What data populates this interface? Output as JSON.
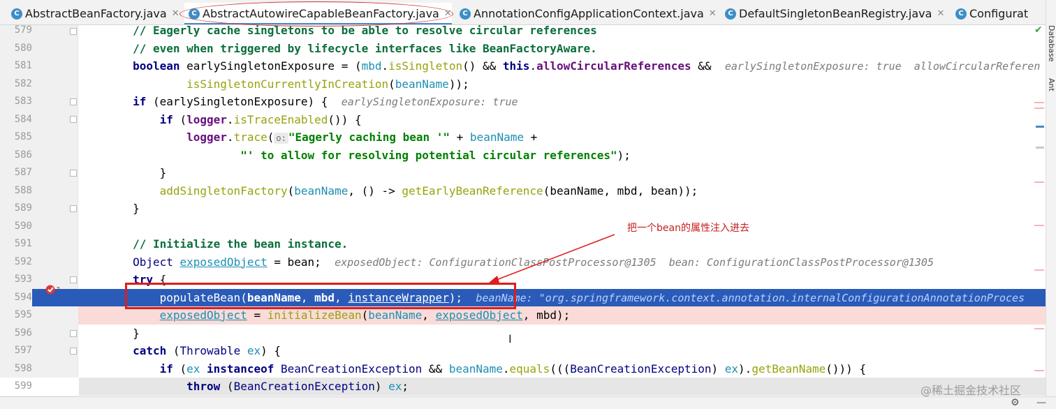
{
  "tabs": [
    {
      "label": "AbstractBeanFactory.java",
      "active": false,
      "icon": "C"
    },
    {
      "label": "AbstractAutowireCapableBeanFactory.java",
      "active": true,
      "icon": "C"
    },
    {
      "label": "AnnotationConfigApplicationContext.java",
      "active": false,
      "icon": "C"
    },
    {
      "label": "DefaultSingletonBeanRegistry.java",
      "active": false,
      "icon": "C"
    },
    {
      "label": "Configurat",
      "active": false,
      "icon": "C"
    }
  ],
  "tool_windows": {
    "database": "Database",
    "ant": "Ant"
  },
  "lines": [
    {
      "num": "579"
    },
    {
      "num": "580"
    },
    {
      "num": "581"
    },
    {
      "num": "582"
    },
    {
      "num": "583"
    },
    {
      "num": "584"
    },
    {
      "num": "585"
    },
    {
      "num": "586"
    },
    {
      "num": "587"
    },
    {
      "num": "588"
    },
    {
      "num": "589"
    },
    {
      "num": "590"
    },
    {
      "num": "591"
    },
    {
      "num": "592"
    },
    {
      "num": "593"
    },
    {
      "num": "594"
    },
    {
      "num": "595"
    },
    {
      "num": "596"
    },
    {
      "num": "597"
    },
    {
      "num": "598"
    },
    {
      "num": "599"
    }
  ],
  "code": {
    "l579_comment": "// Eagerly cache singletons to be able to resolve circular references",
    "l580_comment": "// even when triggered by lifecycle interfaces like BeanFactoryAware.",
    "l581_kw": "boolean",
    "l581_a": " earlySingletonExposure = (",
    "l581_mbd": "mbd",
    "l581_dot": ".",
    "l581_isSingleton": "isSingleton",
    "l581_b": "() && ",
    "l581_this": "this",
    "l581_c": ".",
    "l581_field": "allowCircularReferences",
    "l581_d": " &&",
    "l581_hint": "earlySingletonExposure: true  allowCircularReferen",
    "l582_meth": "isSingletonCurrentlyInCreation",
    "l582_a": "(",
    "l582_var": "beanName",
    "l582_b": "));",
    "l583_kw": "if",
    "l583_a": " (earlySingletonExposure) {",
    "l583_hint": "earlySingletonExposure: true",
    "l584_kw": "if",
    "l584_a": " (",
    "l584_logger": "logger",
    "l584_b": ".",
    "l584_meth": "isTraceEnabled",
    "l584_c": "()) {",
    "l585_logger": "logger",
    "l585_a": ".",
    "l585_meth": "trace",
    "l585_b": "(",
    "l585_pill": "o:",
    "l585_str": "\"Eagerly caching bean '\"",
    "l585_c": " + ",
    "l585_var": "beanName",
    "l585_d": " +",
    "l586_str": "\"' to allow for resolving potential circular references\"",
    "l586_a": ");",
    "l587": "}",
    "l588_meth": "addSingletonFactory",
    "l588_a": "(",
    "l588_v1": "beanName",
    "l588_b": ", () -> ",
    "l588_m2": "getEarlyBeanReference",
    "l588_c": "(",
    "l588_v2": "beanName",
    "l588_d": ", ",
    "l588_v3": "mbd",
    "l588_e": ", ",
    "l588_v4": "bean",
    "l588_f": "));",
    "l589": "}",
    "l591_comment": "// Initialize the bean instance.",
    "l592_type": "Object",
    "l592_var": "exposedObject",
    "l592_a": " = bean;",
    "l592_hint": "exposedObject: ConfigurationClassPostProcessor@1305  bean: ConfigurationClassPostProcessor@1305",
    "l593_kw": "try",
    "l593_a": " {",
    "l594_meth": "populateBean",
    "l594_a": "(",
    "l594_v1": "beanName",
    "l594_b": ", ",
    "l594_v2": "mbd",
    "l594_c": ", ",
    "l594_v3": "instanceWrapper",
    "l594_d": ");",
    "l594_hint": "beanName: \"org.springframework.context.annotation.internalConfigurationAnnotationProces",
    "l595_var": "exposedObject",
    "l595_a": " = ",
    "l595_meth": "initializeBean",
    "l595_b": "(",
    "l595_v1": "beanName",
    "l595_c": ", ",
    "l595_v2": "exposedObject",
    "l595_d": ", ",
    "l595_v3": "mbd",
    "l595_e": ");",
    "l596": "}",
    "l597_kw": "catch",
    "l597_a": " (",
    "l597_type": "Throwable",
    "l597_b": " ",
    "l597_var": "ex",
    "l597_c": ") {",
    "l598_kw": "if",
    "l598_a": " (",
    "l598_v1": "ex",
    "l598_kw2": " instanceof ",
    "l598_type": "BeanCreationException",
    "l598_b": " && ",
    "l598_v2": "beanName",
    "l598_c": ".",
    "l598_meth": "equals",
    "l598_d": "(((",
    "l598_type2": "BeanCreationException",
    "l598_e": ") ",
    "l598_v3": "ex",
    "l598_f": ").",
    "l598_meth2": "getBeanName",
    "l598_g": "())) {",
    "l599_kw": "throw",
    "l599_a": " (",
    "l599_type": "BeanCreationException",
    "l599_b": ") ",
    "l599_var": "ex",
    "l599_c": ";"
  },
  "annotation": {
    "text": "把一个bean的属性注入进去",
    "color": "#c41e1e"
  },
  "watermark": "@稀土掘金技术社区",
  "colors": {
    "current_line": "#2a5bb8",
    "breakpoint_line": "#fadbd8",
    "annotation_red": "#e01c1c"
  }
}
